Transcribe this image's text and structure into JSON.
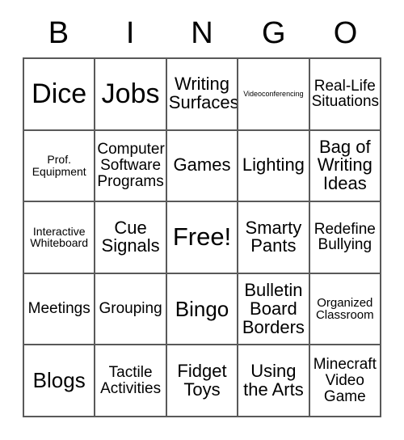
{
  "header": {
    "letters": [
      "B",
      "I",
      "N",
      "G",
      "O"
    ]
  },
  "grid": {
    "rows": 5,
    "columns": 5,
    "border_color": "#595959",
    "background_color": "#ffffff",
    "text_color": "#000000",
    "cells": [
      {
        "text": "Dice",
        "size": "fs-xxl"
      },
      {
        "text": "Jobs",
        "size": "fs-xxl"
      },
      {
        "text": "Writing\nSurfaces",
        "size": "fs-md"
      },
      {
        "text": "Videoconferencing",
        "size": "fs-tiny"
      },
      {
        "text": "Real-Life\nSituations",
        "size": "fs-sm"
      },
      {
        "text": "Prof.\nEquipment",
        "size": "fs-xxs"
      },
      {
        "text": "Computer\nSoftware\nPrograms",
        "size": "fs-sm"
      },
      {
        "text": "Games",
        "size": "fs-md"
      },
      {
        "text": "Lighting",
        "size": "fs-md"
      },
      {
        "text": "Bag of\nWriting\nIdeas",
        "size": "fs-md"
      },
      {
        "text": "Interactive\nWhiteboard",
        "size": "fs-xxs"
      },
      {
        "text": "Cue\nSignals",
        "size": "fs-md"
      },
      {
        "text": "Free!",
        "size": "fs-xl"
      },
      {
        "text": "Smarty\nPants",
        "size": "fs-md"
      },
      {
        "text": "Redefine\nBullying",
        "size": "fs-sm"
      },
      {
        "text": "Meetings",
        "size": "fs-sm"
      },
      {
        "text": "Grouping",
        "size": "fs-sm"
      },
      {
        "text": "Bingo",
        "size": "fs-lg"
      },
      {
        "text": "Bulletin\nBoard\nBorders",
        "size": "fs-md"
      },
      {
        "text": "Organized\nClassroom",
        "size": "fs-xs"
      },
      {
        "text": "Blogs",
        "size": "fs-lg"
      },
      {
        "text": "Tactile\nActivities",
        "size": "fs-sm"
      },
      {
        "text": "Fidget\nToys",
        "size": "fs-md"
      },
      {
        "text": "Using\nthe Arts",
        "size": "fs-md"
      },
      {
        "text": "Minecraft\nVideo\nGame",
        "size": "fs-sm"
      }
    ]
  }
}
